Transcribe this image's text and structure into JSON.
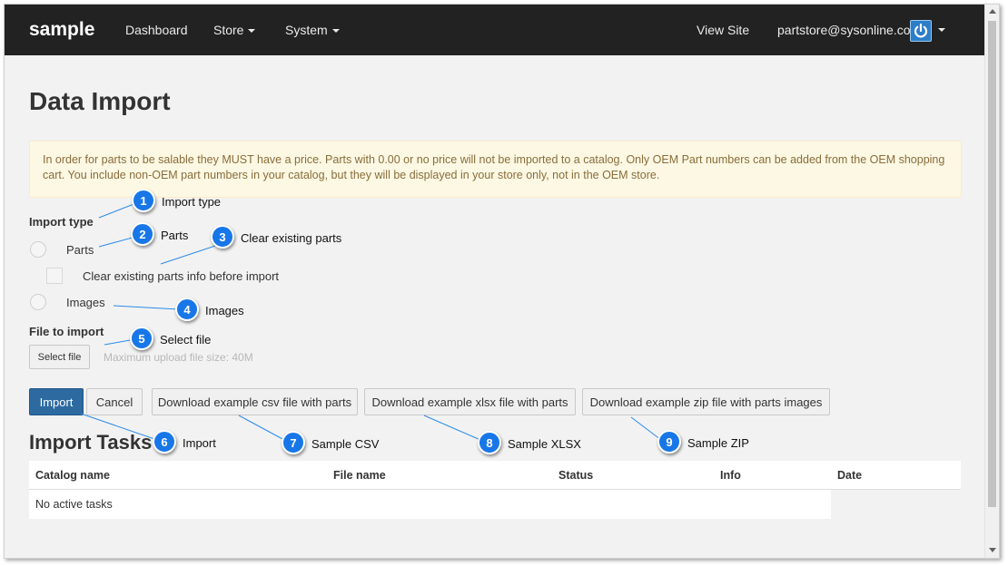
{
  "navbar": {
    "brand": "sample",
    "items": [
      "Dashboard",
      "Store",
      "System"
    ],
    "view_site": "View Site",
    "user_email": "partstore@sysonline.com"
  },
  "page": {
    "title": "Data Import",
    "alert": "In order for parts to be salable they MUST have a price. Parts with 0.00 or no price will not be imported to a catalog. Only OEM Part numbers can be added from the OEM shopping cart. You include non-OEM part numbers in your catalog, but they will be displayed in your store only, not in the OEM store."
  },
  "form": {
    "import_type_label": "Import type",
    "option_parts": "Parts",
    "clear_existing_label": "Clear existing parts info before import",
    "option_images": "Images",
    "file_label": "File to import",
    "select_file_button": "Select file",
    "upload_help": "Maximum upload file size: 40M",
    "import_button": "Import",
    "cancel_button": "Cancel",
    "download_csv_button": "Download example csv file with parts",
    "download_xlsx_button": "Download example xlsx file with parts",
    "download_zip_button": "Download example zip file with parts images"
  },
  "tasks": {
    "title": "Import Tasks",
    "columns": [
      "Catalog name",
      "File name",
      "Status",
      "Info",
      "Date"
    ],
    "empty_text": "No active tasks"
  },
  "callouts": [
    {
      "number": "1",
      "text": "Import type"
    },
    {
      "number": "2",
      "text": "Parts"
    },
    {
      "number": "3",
      "text": "Clear existing parts"
    },
    {
      "number": "4",
      "text": "Images"
    },
    {
      "number": "5",
      "text": "Select file"
    },
    {
      "number": "6",
      "text": "Import"
    },
    {
      "number": "7",
      "text": "Sample CSV"
    },
    {
      "number": "8",
      "text": "Sample XLSX"
    },
    {
      "number": "9",
      "text": "Sample ZIP"
    }
  ],
  "colors": {
    "navbar": "#222222",
    "callout": "#1877e8",
    "primary_button": "#2c6aa0",
    "alert_bg": "#fcf8e3",
    "alert_text": "#8a6d3b"
  }
}
